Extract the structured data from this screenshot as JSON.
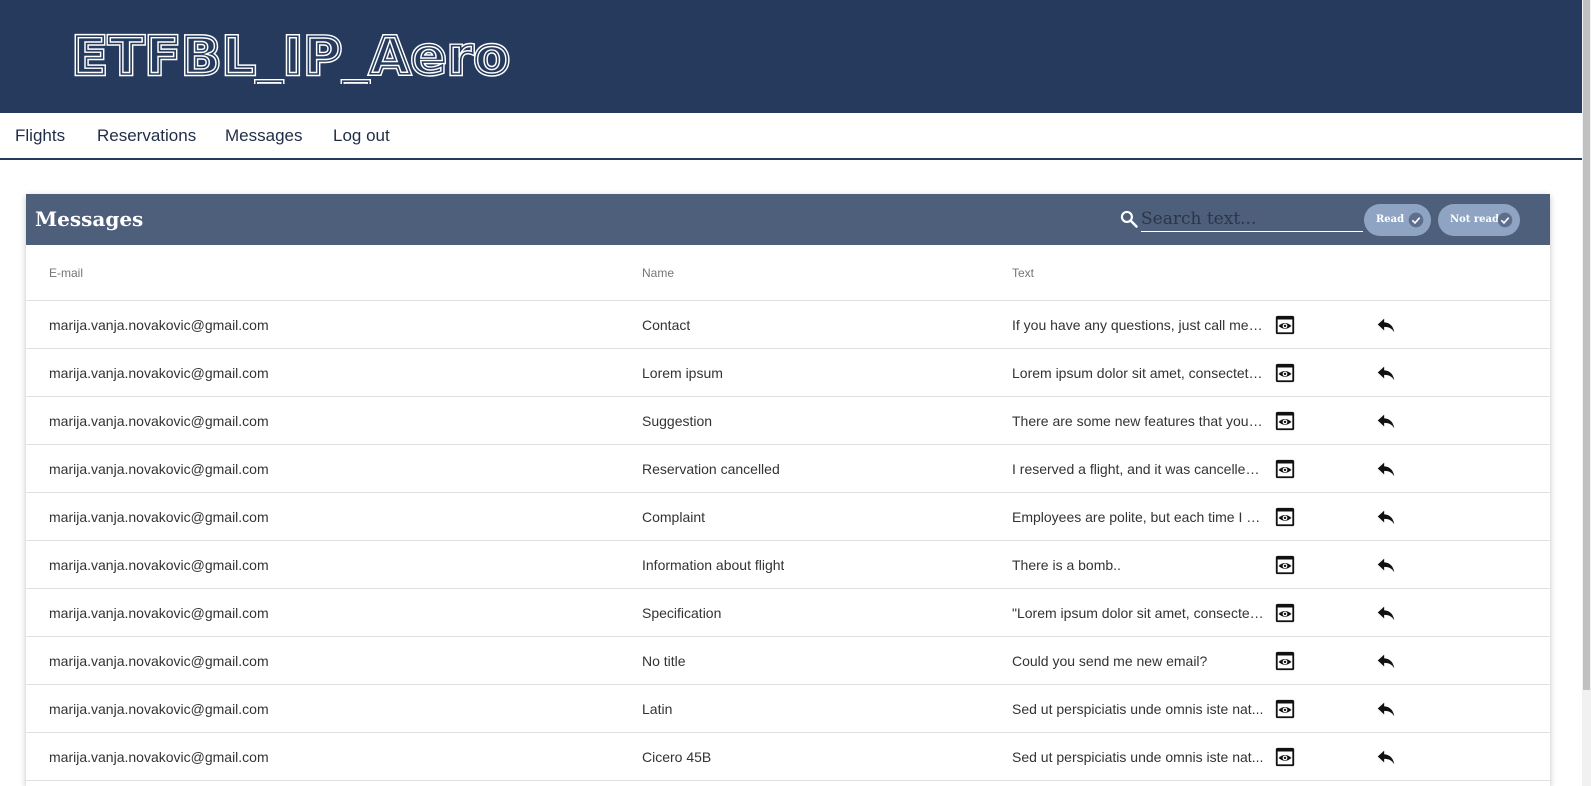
{
  "app": {
    "logo_text": "ETFBL_IP_Aero"
  },
  "nav": {
    "items": [
      {
        "label": "Flights"
      },
      {
        "label": "Reservations"
      },
      {
        "label": "Messages"
      },
      {
        "label": "Log out"
      }
    ]
  },
  "messages": {
    "title": "Messages",
    "search": {
      "placeholder": "Search text...",
      "value": ""
    },
    "filters": [
      {
        "label": "Read",
        "selected": true
      },
      {
        "label": "Not read",
        "selected": true
      }
    ],
    "columns": {
      "email": "E-mail",
      "name": "Name",
      "text": "Text"
    },
    "rows": [
      {
        "email": "marija.vanja.novakovic@gmail.com",
        "name": "Contact",
        "text": "If you have any questions, just call me. I..."
      },
      {
        "email": "marija.vanja.novakovic@gmail.com",
        "name": "Lorem ipsum",
        "text": "Lorem ipsum dolor sit amet, consectetu..."
      },
      {
        "email": "marija.vanja.novakovic@gmail.com",
        "name": "Suggestion",
        "text": "There are some new features that you c..."
      },
      {
        "email": "marija.vanja.novakovic@gmail.com",
        "name": "Reservation cancelled",
        "text": "I reserved a flight, and it was cancelled ..."
      },
      {
        "email": "marija.vanja.novakovic@gmail.com",
        "name": "Complaint",
        "text": "Employees are polite, but each time I re..."
      },
      {
        "email": "marija.vanja.novakovic@gmail.com",
        "name": "Information about flight",
        "text": "There is a bomb.."
      },
      {
        "email": "marija.vanja.novakovic@gmail.com",
        "name": "Specification",
        "text": "\"Lorem ipsum dolor sit amet, consectet..."
      },
      {
        "email": "marija.vanja.novakovic@gmail.com",
        "name": "No title",
        "text": "Could you send me new email?"
      },
      {
        "email": "marija.vanja.novakovic@gmail.com",
        "name": "Latin",
        "text": "Sed ut perspiciatis unde omnis iste nat..."
      },
      {
        "email": "marija.vanja.novakovic@gmail.com",
        "name": "Cicero 45B",
        "text": "Sed ut perspiciatis unde omnis iste nat..."
      }
    ],
    "row_actions": {
      "view_icon": "eye-icon",
      "reply_icon": "reply-icon"
    }
  },
  "colors": {
    "banner": "#253a5c",
    "card_header": "#4e5f7b",
    "chip": "#8fa4c3",
    "nav_text": "#1f2d45"
  }
}
